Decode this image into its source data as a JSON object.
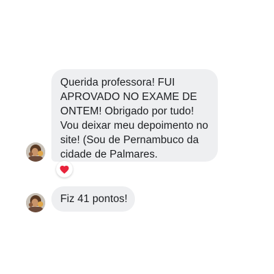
{
  "messages": [
    {
      "lines": [
        "Querida professora! FUI",
        "APROVADO NO EXAME DE",
        "ONTEM! Obrigado por tudo!",
        "Vou deixar meu depoimento no",
        "site! (Sou de Pernambuco da",
        "cidade de Palmares."
      ],
      "reaction_icon": "heart-icon",
      "reaction_color": "#e8233b"
    },
    {
      "text": "Fiz 41 pontos!"
    }
  ],
  "colors": {
    "bubble_background": "#eeeff1",
    "text": "#1c1e21",
    "page_background": "#ffffff"
  }
}
